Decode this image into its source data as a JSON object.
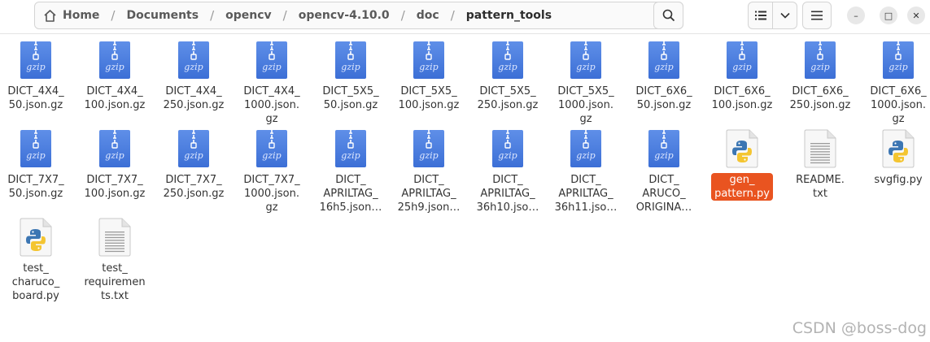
{
  "breadcrumb": [
    "Home",
    "Documents",
    "opencv",
    "opencv-4.10.0",
    "doc",
    "pattern_tools"
  ],
  "header": {
    "path_menu_icon": "kebab-vertical-icon",
    "search_icon": "search-icon",
    "view_list_icon": "list-view-icon",
    "view_dropdown_icon": "chevron-down-icon",
    "menu_icon": "hamburger-icon",
    "minimize_label": "–",
    "maximize_label": "□",
    "close_label": "✕"
  },
  "accent_color": "#e95420",
  "files": [
    {
      "label": "DICT_4X4_\n50.json.gz",
      "type": "gzip"
    },
    {
      "label": "DICT_4X4_\n100.json.gz",
      "type": "gzip"
    },
    {
      "label": "DICT_4X4_\n250.json.gz",
      "type": "gzip"
    },
    {
      "label": "DICT_4X4_\n1000.json.\ngz",
      "type": "gzip"
    },
    {
      "label": "DICT_5X5_\n50.json.gz",
      "type": "gzip"
    },
    {
      "label": "DICT_5X5_\n100.json.gz",
      "type": "gzip"
    },
    {
      "label": "DICT_5X5_\n250.json.gz",
      "type": "gzip"
    },
    {
      "label": "DICT_5X5_\n1000.json.\ngz",
      "type": "gzip"
    },
    {
      "label": "DICT_6X6_\n50.json.gz",
      "type": "gzip"
    },
    {
      "label": "DICT_6X6_\n100.json.gz",
      "type": "gzip"
    },
    {
      "label": "DICT_6X6_\n250.json.gz",
      "type": "gzip"
    },
    {
      "label": "DICT_6X6_\n1000.json.\ngz",
      "type": "gzip"
    },
    {
      "label": "DICT_7X7_\n50.json.gz",
      "type": "gzip"
    },
    {
      "label": "DICT_7X7_\n100.json.gz",
      "type": "gzip"
    },
    {
      "label": "DICT_7X7_\n250.json.gz",
      "type": "gzip"
    },
    {
      "label": "DICT_7X7_\n1000.json.\ngz",
      "type": "gzip"
    },
    {
      "label": "DICT_\nAPRILTAG_\n16h5.json…",
      "type": "gzip"
    },
    {
      "label": "DICT_\nAPRILTAG_\n25h9.json…",
      "type": "gzip"
    },
    {
      "label": "DICT_\nAPRILTAG_\n36h10.jso…",
      "type": "gzip"
    },
    {
      "label": "DICT_\nAPRILTAG_\n36h11.jso…",
      "type": "gzip"
    },
    {
      "label": "DICT_\nARUCO_\nORIGINA…",
      "type": "gzip"
    },
    {
      "label": "gen_\npattern.py",
      "type": "python",
      "selected": true
    },
    {
      "label": "README.\ntxt",
      "type": "text"
    },
    {
      "label": "svgfig.py",
      "type": "python"
    },
    {
      "label": "test_\ncharuco_\nboard.py",
      "type": "python"
    },
    {
      "label": "test_\nrequiremen\nts.txt",
      "type": "text"
    }
  ],
  "watermark": "CSDN @boss-dog"
}
